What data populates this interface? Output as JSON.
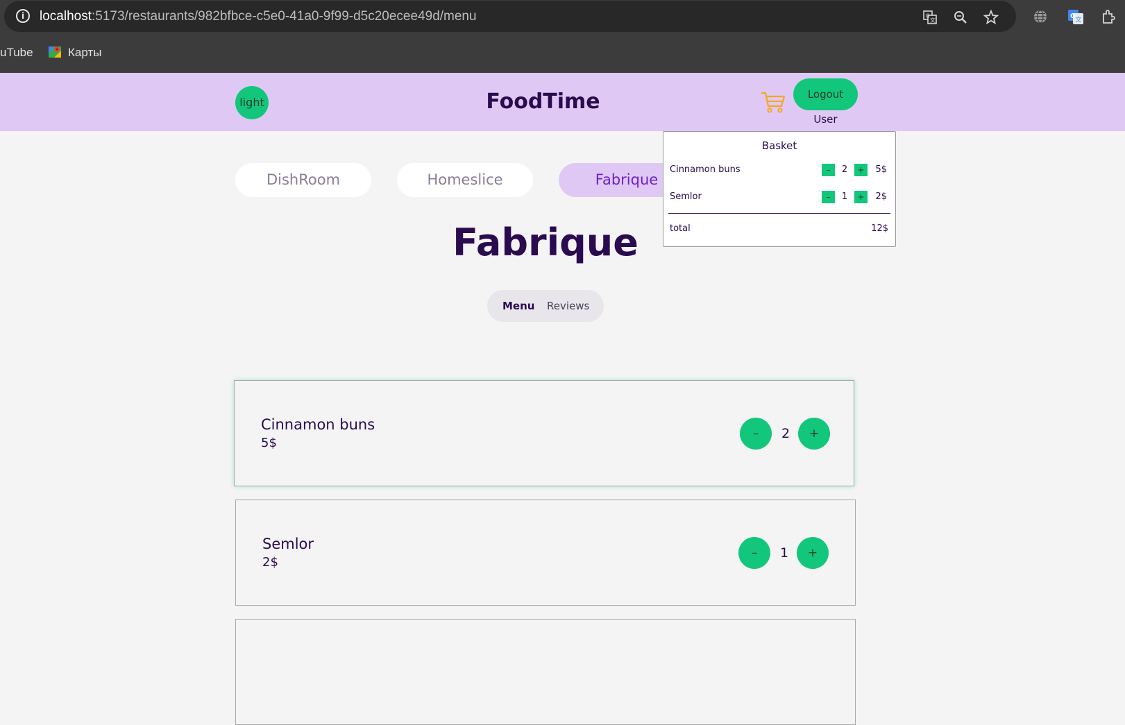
{
  "browser": {
    "url_host": "localhost",
    "url_path": ":5173/restaurants/982bfbce-c5e0-41a0-9f99-d5c20ecee49d/menu",
    "bookmarks": [
      {
        "label": "uTube"
      },
      {
        "label": "Карты",
        "icon": "google-maps-icon"
      }
    ],
    "toolbar_icons": [
      "translate-icon",
      "zoom-icon",
      "bookmark-star-icon",
      "globe-icon",
      "google-translate-icon",
      "extensions-icon"
    ]
  },
  "header": {
    "theme_label": "light",
    "brand": "FoodTime",
    "cart_icon": "shopping-cart-icon",
    "logout_label": "Logout",
    "user_name": "User"
  },
  "restaurants": [
    {
      "name": "DishRoom",
      "active": false
    },
    {
      "name": "Homeslice",
      "active": false
    },
    {
      "name": "Fabrique",
      "active": true
    }
  ],
  "page": {
    "title": "Fabrique",
    "tabs": [
      {
        "label": "Menu",
        "active": true
      },
      {
        "label": "Reviews",
        "active": false
      }
    ]
  },
  "dishes": [
    {
      "name": "Cinnamon buns",
      "price": "5$",
      "count": "2",
      "minus": "–",
      "plus": "+"
    },
    {
      "name": "Semlor",
      "price": "2$",
      "count": "1",
      "minus": "–",
      "plus": "+"
    }
  ],
  "basket": {
    "title": "Basket",
    "items": [
      {
        "name": "Cinnamon buns",
        "count": "2",
        "price": "5$",
        "minus": "–",
        "plus": "+"
      },
      {
        "name": "Semlor",
        "count": "1",
        "price": "2$",
        "minus": "–",
        "plus": "+"
      }
    ],
    "total_label": "total",
    "total_value": "12$"
  },
  "colors": {
    "accent_green": "#12c77c",
    "header_lavender": "#dfc9f4",
    "text_dark_purple": "#2a0b4f",
    "active_tab_text": "#6d1fd1",
    "cart_orange": "#f5a623"
  }
}
